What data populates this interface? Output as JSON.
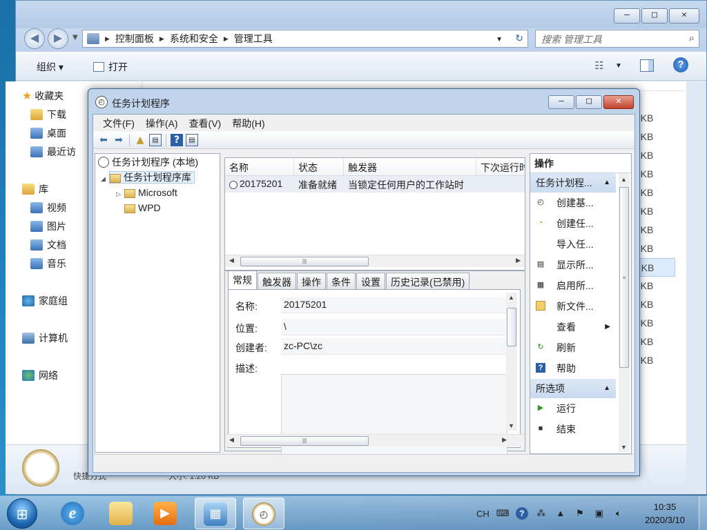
{
  "explorer": {
    "window_controls": {
      "minimize": "—",
      "maximize": "□",
      "close": "✕"
    },
    "breadcrumb": [
      "控制面板",
      "系统和安全",
      "管理工具"
    ],
    "search_placeholder": "搜索 管理工具",
    "toolbar": {
      "organize": "组织",
      "open": "打开"
    },
    "nav": {
      "favorites": "收藏夹",
      "downloads": "下载",
      "desktop": "桌面",
      "recent": "最近访",
      "libraries": "库",
      "videos": "视频",
      "pictures": "图片",
      "documents": "文档",
      "music": "音乐",
      "homegroup": "家庭组",
      "computer": "计算机",
      "network": "网络"
    },
    "sizes": [
      "2 KB",
      "3 KB",
      "2 KB",
      "2 KB",
      "2 KB",
      "2 KB",
      "2 KB",
      "2 KB",
      "2 KB",
      "2 KB",
      "2 KB",
      "2 KB",
      "2 KB",
      "2 KB"
    ],
    "details": {
      "line1": "快捷方式",
      "line2": "大小: 1.20 KB"
    }
  },
  "task_scheduler": {
    "title": "任务计划程序",
    "menu": [
      "文件(F)",
      "操作(A)",
      "查看(V)",
      "帮助(H)"
    ],
    "tree": {
      "root": "任务计划程序 (本地)",
      "library": "任务计划程序库",
      "child1": "Microsoft",
      "child2": "WPD"
    },
    "list": {
      "columns": [
        "名称",
        "状态",
        "触发器",
        "下次运行时"
      ],
      "rows": [
        {
          "name": "20175201",
          "status": "准备就绪",
          "trigger": "当锁定任何用户的工作站时",
          "next": ""
        }
      ]
    },
    "tabs": [
      "常规",
      "触发器",
      "操作",
      "条件",
      "设置",
      "历史记录(已禁用)"
    ],
    "general": {
      "name_label": "名称:",
      "name_value": "20175201",
      "location_label": "位置:",
      "location_value": "\\",
      "author_label": "创建者:",
      "author_value": "zc-PC\\zc",
      "description_label": "描述:"
    },
    "actions": {
      "header": "操作",
      "group1": "任务计划程...",
      "items": [
        "创建基...",
        "创建任...",
        "导入任...",
        "显示所...",
        "启用所...",
        "新文件...",
        "查看",
        "刷新",
        "帮助"
      ],
      "group2": "所选项",
      "selected_items": [
        "运行",
        "结束"
      ]
    }
  },
  "taskbar": {
    "ime": "CH",
    "time": "10:35",
    "date": "2020/3/10"
  }
}
